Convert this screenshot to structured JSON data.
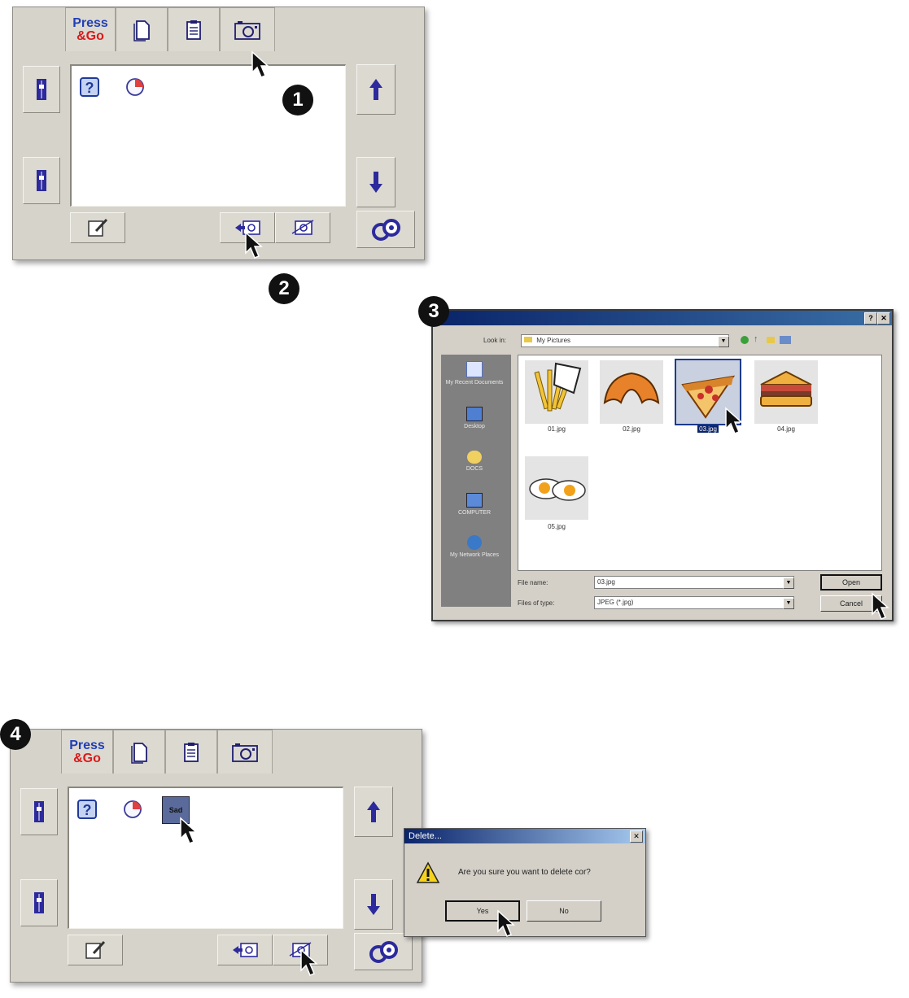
{
  "steps": {
    "s1": "1",
    "s2": "2",
    "s3": "3",
    "s4": "4"
  },
  "press_go": {
    "logo_line1": "Press",
    "logo_line2": "&Go",
    "clip_label": "Sad"
  },
  "open_dialog": {
    "look_in_label": "Look in:",
    "look_in_value": "My Pictures",
    "places": [
      "My Recent Documents",
      "Desktop",
      "DOCS",
      "COMPUTER",
      "My Network Places"
    ],
    "files": [
      "01.jpg",
      "02.jpg",
      "03.jpg",
      "04.jpg",
      "05.jpg"
    ],
    "file_name_label": "File name:",
    "file_name_value": "03.jpg",
    "file_type_label": "Files of type:",
    "file_type_value": "JPEG (*.jpg)",
    "open_button": "Open",
    "cancel_button": "Cancel"
  },
  "delete_dialog": {
    "title": "Delete...",
    "message": "Are you sure you want to delete cor?",
    "yes": "Yes",
    "no": "No"
  },
  "colors": {
    "panel": "#d6d3cb",
    "arrow": "#2c2a9c",
    "title_bar": "#0a246a"
  }
}
